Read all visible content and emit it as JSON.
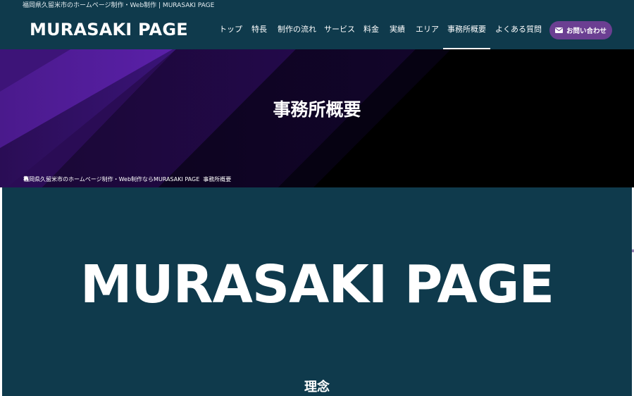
{
  "header": {
    "tagline": "福岡県久留米市のホームページ制作・Web制作 | MURASAKI PAGE",
    "logo": "MURASAKI PAGE",
    "nav": [
      {
        "label": "トップ",
        "active": false
      },
      {
        "label": "特長",
        "active": false
      },
      {
        "label": "制作の流れ",
        "active": false
      },
      {
        "label": "サービス",
        "active": false
      },
      {
        "label": "料金",
        "active": false
      },
      {
        "label": "実績",
        "active": false
      },
      {
        "label": "エリア",
        "active": false
      },
      {
        "label": "事務所概要",
        "active": true
      },
      {
        "label": "よくある質問",
        "active": false
      }
    ],
    "contact_label": "お問い合わせ",
    "contact_icon": "mail-icon"
  },
  "hero": {
    "title": "事務所概要",
    "breadcrumb": {
      "home_icon": "home-icon",
      "home_label": "福岡県久留米市のホームページ制作・Web制作ならMURASAKI PAGE",
      "current": "事務所概要"
    }
  },
  "main": {
    "big_title": "MURASAKI PAGE",
    "heading": "理念"
  },
  "colors": {
    "header_bg": "#0f3a4c",
    "accent_purple": "#6b3f92",
    "hero_bg": "#000000"
  }
}
